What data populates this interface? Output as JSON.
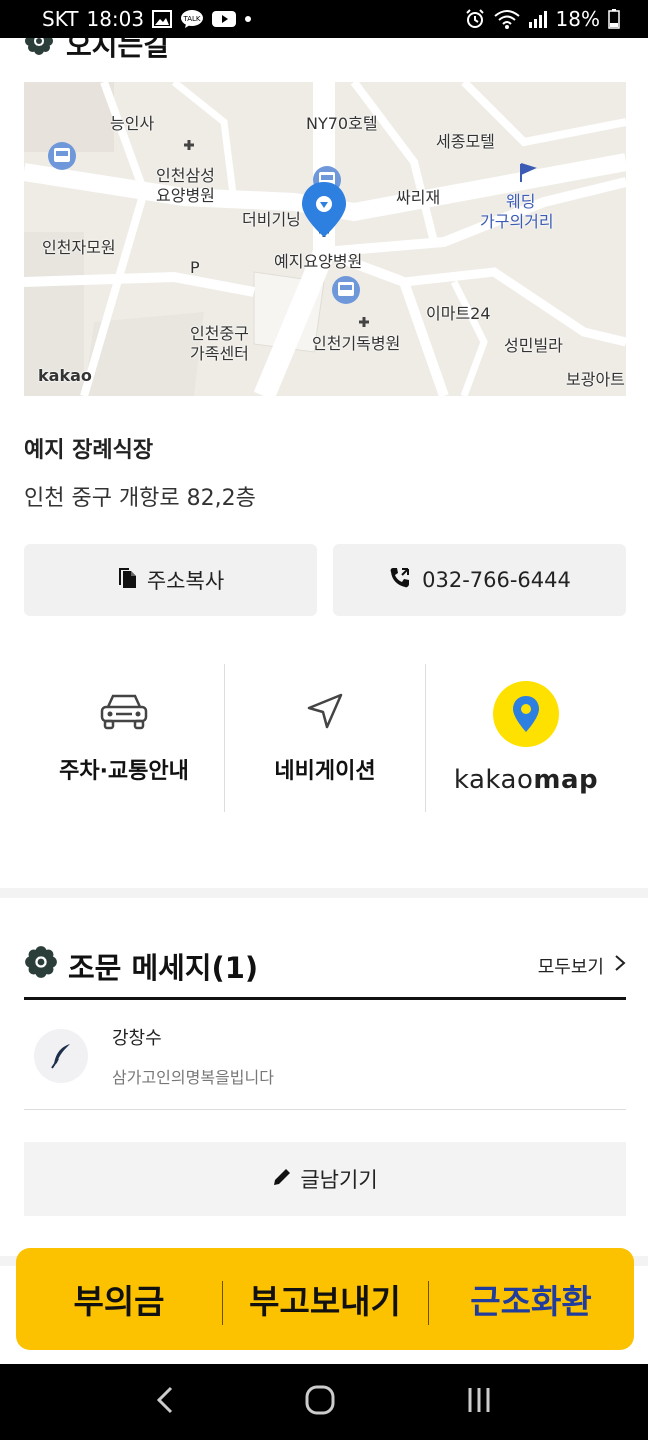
{
  "status_bar": {
    "carrier": "SKT",
    "time": "18:03",
    "battery": "18%"
  },
  "location": {
    "section_title_partial": "오시는길",
    "map_labels": [
      "능인사",
      "NY70호텔",
      "세종모텔",
      "인천삼성",
      "요양병원",
      "싸리재",
      "웨딩",
      "가구의거리",
      "더비기닝",
      "인천자모원",
      "P",
      "예지요양병원",
      "이마트24",
      "인천중구",
      "가족센터",
      "인천기독병원",
      "성민빌라",
      "보광아트",
      "kakao"
    ],
    "place_name": "예지 장례식장",
    "address": "인천 중구 개항로 82,2층",
    "copy_address_label": "주소복사",
    "phone_label": "032-766-6444",
    "nav_options": [
      {
        "label": "주차·교통안내"
      },
      {
        "label": "네비게이션"
      },
      {
        "label_light": "kakao",
        "label_bold": "map"
      }
    ]
  },
  "messages": {
    "title": "조문 메세지(1)",
    "view_all": "모두보기",
    "items": [
      {
        "name": "강창수",
        "text": "삼가고인의명복을빕니다"
      }
    ],
    "write_label": "글남기기"
  },
  "action_bar": {
    "items": [
      "부의금",
      "부고보내기",
      "근조화환"
    ]
  },
  "colors": {
    "accent_yellow": "#fcc200",
    "kakao_yellow": "#ffe100",
    "blue_text": "#1f3c9e"
  }
}
